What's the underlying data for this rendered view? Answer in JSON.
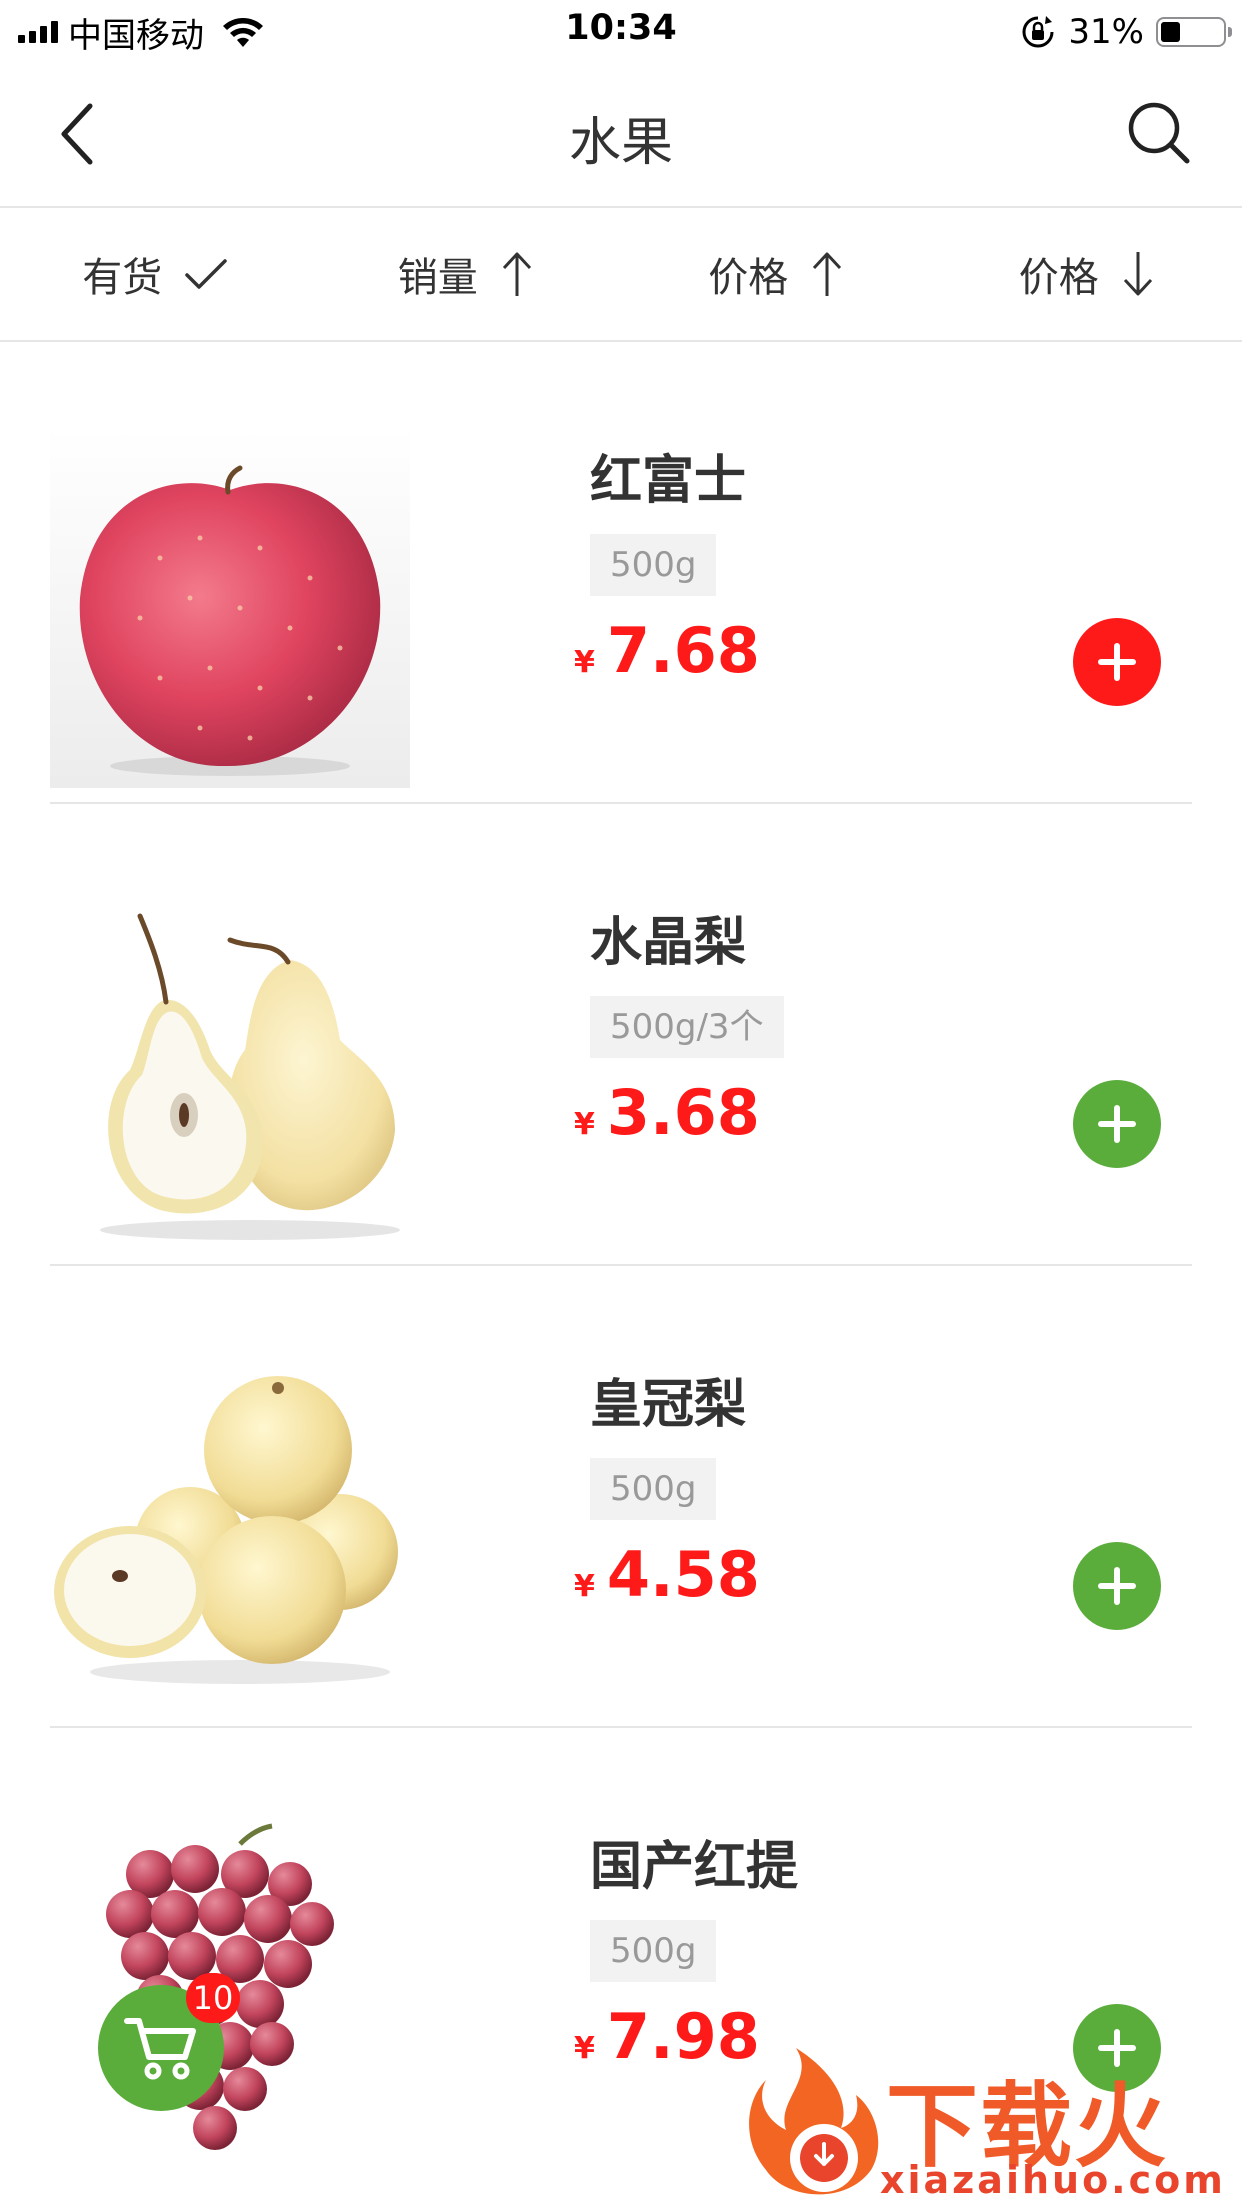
{
  "status_bar": {
    "carrier": "中国移动",
    "time": "10:34",
    "battery_percent": "31%",
    "battery_level": 0.31
  },
  "nav": {
    "title": "水果",
    "back_icon": "chevron-left-icon",
    "search_icon": "search-icon"
  },
  "filters": [
    {
      "label": "有货",
      "icon": "check-icon"
    },
    {
      "label": "销量",
      "icon": "arrow-up-icon"
    },
    {
      "label": "价格",
      "icon": "arrow-up-icon"
    },
    {
      "label": "价格",
      "icon": "arrow-down-icon"
    }
  ],
  "products": [
    {
      "name": "红富士",
      "spec": "500g",
      "currency": "¥",
      "price": "7.68",
      "add_color": "#ff1a1a",
      "image": "apple"
    },
    {
      "name": "水晶梨",
      "spec": "500g/3个",
      "currency": "¥",
      "price": "3.68",
      "add_color": "#5aad3a",
      "image": "crystal-pear"
    },
    {
      "name": "皇冠梨",
      "spec": "500g",
      "currency": "¥",
      "price": "4.58",
      "add_color": "#5aad3a",
      "image": "crown-pear"
    },
    {
      "name": "国产红提",
      "spec": "500g",
      "currency": "¥",
      "price": "7.98",
      "add_color": "#5aad3a",
      "image": "red-grapes"
    }
  ],
  "cart": {
    "icon": "cart-icon",
    "count": "10",
    "color": "#5aad3a"
  },
  "watermark": {
    "text": "下载火",
    "sub": "xiazaihuo.com"
  },
  "colors": {
    "price": "#ff1a1a",
    "accent_green": "#5aad3a",
    "divider": "#e6e6e6"
  }
}
